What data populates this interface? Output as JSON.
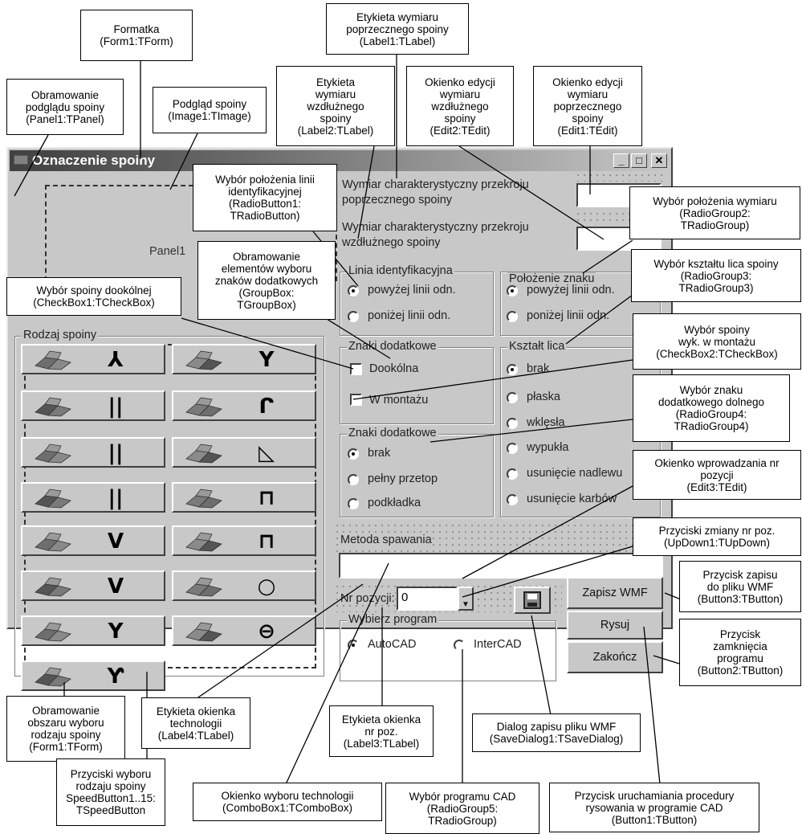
{
  "window": {
    "title": "Oznaczenie spoiny",
    "minimize_glyph": "_",
    "maximize_glyph": "□",
    "close_glyph": "✕"
  },
  "form": {
    "panel_label": "Panel1",
    "label_transverse_1": "Wymiar charakterystyczny przekroju",
    "label_transverse_2": "poprzecznego spoiny",
    "label_longitudinal_1": "Wymiar charakterystyczny przekroju",
    "label_longitudinal_2": "wzdłużnego spoiny",
    "edit1_value": "",
    "edit2_value": "",
    "id_line_group": {
      "caption": "Linia identyfikacyjna",
      "options": [
        "powyżej linii odn.",
        "poniżej linii odn."
      ]
    },
    "sign_position_group": {
      "caption": "Położenie znaku",
      "options": [
        "powyżej linii odn.",
        "poniżej linii odn."
      ]
    },
    "extra_signs_group": {
      "caption": "Znaki dodatkowe",
      "checkbox_all_around": "Dookólna",
      "checkbox_mounting": "W montażu"
    },
    "face_shape_group": {
      "caption": "Kształt lica",
      "options": [
        "brak",
        "płaska",
        "wklęsła",
        "wypukła",
        "usunięcie nadlewu",
        "usunięcie karbów"
      ]
    },
    "extra_signs_lower_group": {
      "caption": "Znaki dodatkowe",
      "options": [
        "brak",
        "pełny przetop",
        "podkładka"
      ]
    },
    "weld_type_group": {
      "caption": "Rodzaj spoiny"
    },
    "welding_method_label": "Metoda spawania",
    "welding_method_value": "",
    "position_label": "Nr pozycji:",
    "position_value": "0",
    "program_group": {
      "caption": "Wybierz program",
      "options": [
        "AutoCAD",
        "InterCAD"
      ]
    },
    "buttons": {
      "save_wmf": "Zapisz WMF",
      "draw": "Rysuj",
      "close": "Zakończ"
    }
  },
  "weld_buttons": [
    {
      "symbol": "⅄",
      "icon": "fillet-weld-3d-icon"
    },
    {
      "symbol": "Y",
      "icon": "u-groove-weld-3d-icon"
    },
    {
      "symbol": "||",
      "icon": "square-butt-weld-3d-icon"
    },
    {
      "symbol": "ᒋ",
      "icon": "j-groove-weld-3d-icon"
    },
    {
      "symbol": "||",
      "icon": "plate-butt-weld-3d-icon"
    },
    {
      "symbol": "◺",
      "icon": "fillet-tee-weld-3d-icon"
    },
    {
      "symbol": "||",
      "icon": "block-weld-3d-icon"
    },
    {
      "symbol": "⊓",
      "icon": "plug-weld-3d-icon"
    },
    {
      "symbol": "V",
      "icon": "v-groove-weld-3d-icon"
    },
    {
      "symbol": "⊓",
      "icon": "slot-weld-3d-icon"
    },
    {
      "symbol": "V",
      "icon": "bevel-groove-weld-3d-icon"
    },
    {
      "symbol": "○",
      "icon": "spot-weld-3d-icon"
    },
    {
      "symbol": "Y",
      "icon": "y-groove-weld-3d-icon"
    },
    {
      "symbol": "⊖",
      "icon": "seam-weld-3d-icon"
    },
    {
      "symbol": "Ƴ",
      "icon": "bevel-y-weld-3d-icon"
    }
  ],
  "callouts": {
    "form1": "Formatka\n(Form1:TForm)",
    "label1": "Etykieta wymiaru\npoprzecznego spoiny\n(Label1:TLabel)",
    "panel1": "Obramowanie\npodglądu spoiny\n(Panel1:TPanel)",
    "image1": "Podgląd spoiny\n(Image1:TImage)",
    "label2": "Etykieta\nwymiaru\nwzdłużnego\nspoiny\n(Label2:TLabel)",
    "edit2": "Okienko edycji\nwymiaru\nwzdłużnego\nspoiny\n(Edit2:TEdit)",
    "edit1": "Okienko edycji\nwymiaru\npoprzecznego\nspoiny\n(Edit1:TEdit)",
    "radiobutton1": "Wybór położenia linii\nidentyfikacyjnej\n(RadioButton1:\nTRadioButton)",
    "radiogroup2": "Wybór położenia wymiaru\n(RadioGroup2:\nTRadioGroup)",
    "groupbox": "Obramowanie\nelementów wyboru\nznaków dodatkowych\n(GroupBox:\nTGroupBox)",
    "radiogroup3": "Wybór kształtu lica spoiny\n(RadioGroup3:\nTRadioGroup3)",
    "checkbox1": "Wybór spoiny dookólnej\n(CheckBox1:TCheckBox)",
    "checkbox2": "Wybór spoiny\nwyk. w montażu\n(CheckBox2:TCheckBox)",
    "radiogroup4": "Wybór znaku\ndodatkowego dolnego\n(RadioGroup4:\nTRadioGroup4)",
    "edit3": "Okienko wprowadzania nr\npozycji\n(Edit3:TEdit)",
    "updown1": "Przyciski zmiany nr poz.\n(UpDown1:TUpDown)",
    "button3": "Przycisk zapisu\ndo pliku WMF\n(Button3:TButton)",
    "button2": "Przycisk\nzamknięcia\nprogramu\n(Button2:TButton)",
    "form1_area": "Obramowanie\nobszaru wyboru\nrodzaju spoiny\n(Form1:TForm)",
    "label4": "Etykieta okienka\ntechnologii\n(Label4:TLabel)",
    "label3": "Etykieta okienka\nnr poz.\n(Label3:TLabel)",
    "savedialog1": "Dialog zapisu pliku WMF\n(SaveDialog1:TSaveDialog)",
    "speedbuttons": "Przyciski wyboru\nrodzaju spoiny\nSpeedButton1..15:\nTSpeedButton",
    "combobox1": "Okienko wyboru technologii\n(ComboBox1:TComboBox)",
    "radiogroup5": "Wybór programu CAD\n(RadioGroup5:\nTRadioGroup)",
    "button1": "Przycisk uruchamiania procedury\nrysowania w programie CAD\n(Button1:TButton)"
  }
}
